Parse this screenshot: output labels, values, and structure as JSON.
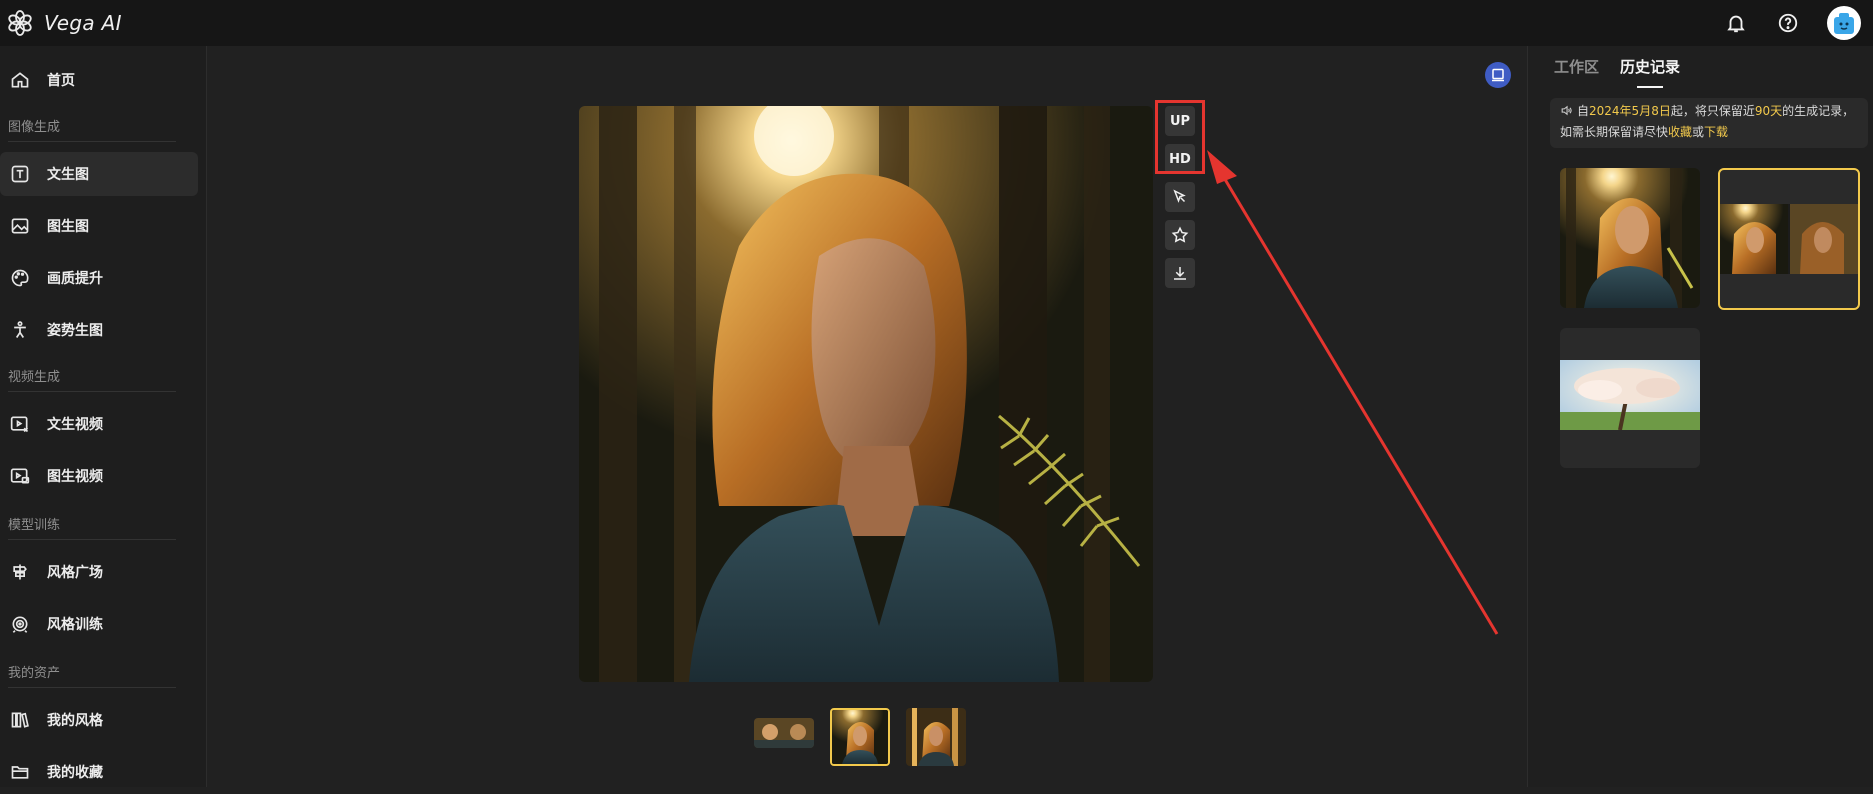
{
  "app": {
    "brand": "Vega AI"
  },
  "header": {
    "icons": [
      "bell-icon",
      "help-icon",
      "avatar"
    ]
  },
  "sidebar": {
    "items": [
      {
        "label": "首页",
        "icon": "home-icon"
      },
      {
        "section": "图像生成"
      },
      {
        "label": "文生图",
        "icon": "text-box-icon",
        "active": true
      },
      {
        "label": "图生图",
        "icon": "image-icon"
      },
      {
        "label": "画质提升",
        "icon": "palette-icon"
      },
      {
        "label": "姿势生图",
        "icon": "pose-icon"
      },
      {
        "section": "视频生成"
      },
      {
        "label": "文生视频",
        "icon": "video-text-icon"
      },
      {
        "label": "图生视频",
        "icon": "video-image-icon"
      },
      {
        "section": "模型训练"
      },
      {
        "label": "风格广场",
        "icon": "signpost-icon"
      },
      {
        "label": "风格训练",
        "icon": "target-icon"
      },
      {
        "section": "我的资产"
      },
      {
        "label": "我的风格",
        "icon": "books-icon"
      },
      {
        "label": "我的收藏",
        "icon": "folder-icon"
      }
    ]
  },
  "main": {
    "tools": {
      "up_label": "UP",
      "hd_label": "HD",
      "icons": [
        "select-cursor-icon",
        "star-icon",
        "download-icon"
      ]
    },
    "thumbnails": {
      "count": 3,
      "selected_index": 1
    }
  },
  "right_panel": {
    "tabs": [
      {
        "label": "工作区",
        "active": false
      },
      {
        "label": "历史记录",
        "active": true
      }
    ],
    "notice": {
      "pre": "自",
      "date": "2024年5月8日",
      "mid": "起，将只保留近",
      "days": "90天",
      "post": "的生成记录，",
      "line2_pre": "如需长期保留请尽快",
      "collect": "收藏",
      "or": "或",
      "download": "下载"
    },
    "history": {
      "count": 3,
      "selected_index": 1
    }
  },
  "colors": {
    "accent_yellow": "#f2c94c",
    "highlight_red": "#e5352f",
    "panel_bg": "#1f1f1f",
    "corner_button": "#3f5cc4"
  }
}
